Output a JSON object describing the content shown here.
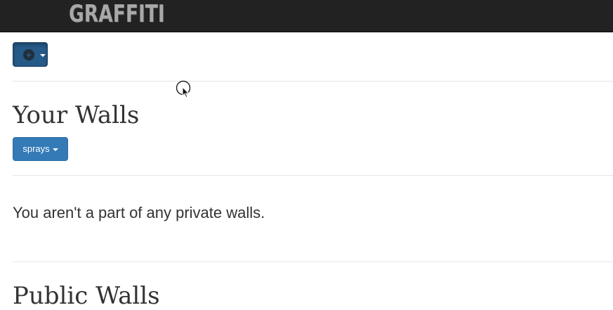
{
  "navbar": {
    "brand": "GRAFFITI"
  },
  "toolbar": {
    "add_icon": "plus-circle-icon",
    "add_caret_icon": "caret-down-icon"
  },
  "your_walls": {
    "title": "Your Walls",
    "sprays_label": "sprays",
    "empty_message": "You aren't a part of any private walls."
  },
  "public_walls": {
    "title": "Public Walls"
  },
  "colors": {
    "navbar_bg": "#222222",
    "primary": "#337ab7",
    "primary_active": "#265a88",
    "text": "#333333"
  }
}
